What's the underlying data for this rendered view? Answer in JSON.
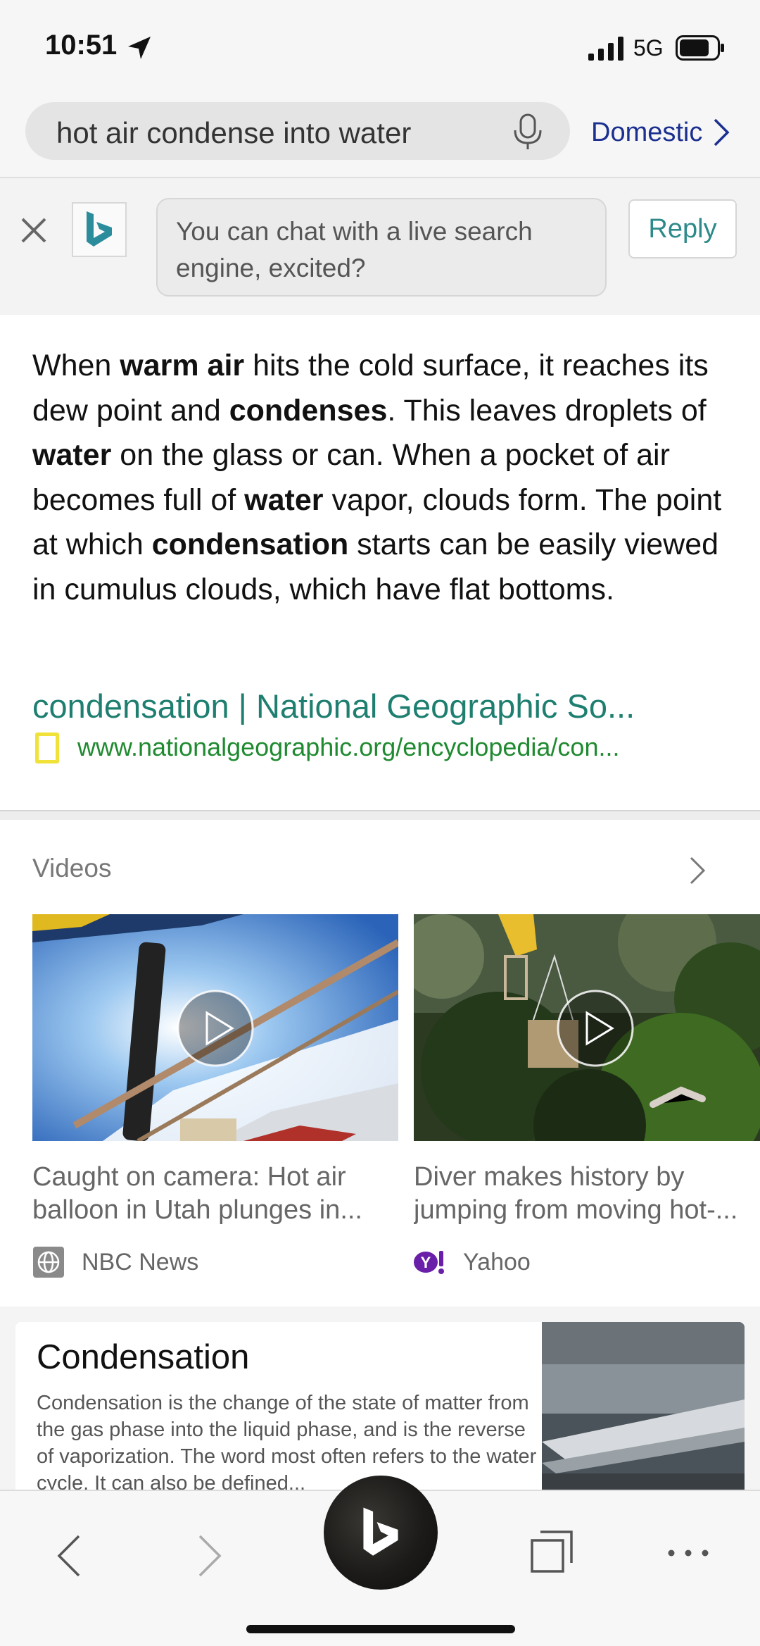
{
  "status": {
    "time": "10:51",
    "network": "5G"
  },
  "search": {
    "query": "hot air condense into water",
    "region_label": "Domestic"
  },
  "chat_banner": {
    "message": "You can chat with a live search engine, excited?",
    "reply_label": "Reply"
  },
  "answer": {
    "segments": [
      {
        "text": "When ",
        "bold": false
      },
      {
        "text": "warm air",
        "bold": true
      },
      {
        "text": " hits the cold surface, it reaches its dew point and ",
        "bold": false
      },
      {
        "text": "condenses",
        "bold": true
      },
      {
        "text": ". This leaves droplets of ",
        "bold": false
      },
      {
        "text": "water",
        "bold": true
      },
      {
        "text": " on the glass or can. When a pocket of air becomes full of ",
        "bold": false
      },
      {
        "text": "water",
        "bold": true
      },
      {
        "text": " vapor, clouds form. The point at which ",
        "bold": false
      },
      {
        "text": "condensation",
        "bold": true
      },
      {
        "text": " starts can be easily viewed in cumulus clouds, which have flat bottoms.",
        "bold": false
      }
    ],
    "source_title": "condensation | National Geographic So...",
    "source_url": "www.nationalgeographic.org/encyclopedia/con..."
  },
  "videos": {
    "title": "Videos",
    "items": [
      {
        "title_line1": "Caught on camera: Hot air",
        "title_line2": "balloon in Utah plunges in...",
        "source": "NBC News",
        "source_icon": "globe-icon"
      },
      {
        "title_line1": "Diver makes history by",
        "title_line2": "jumping from moving hot-...",
        "source": "Yahoo",
        "source_icon": "yahoo-icon"
      }
    ]
  },
  "card": {
    "title": "Condensation",
    "text": "Condensation is the change of the state of matter from the gas phase into the liquid phase, and is the reverse of vaporization. The word most often refers to the water cycle. It can also be defined..."
  },
  "colors": {
    "link_green": "#1e7f70",
    "url_green": "#1f8a30",
    "domestic_blue": "#1a2f8f",
    "bing_teal": "#2b8c9c"
  }
}
